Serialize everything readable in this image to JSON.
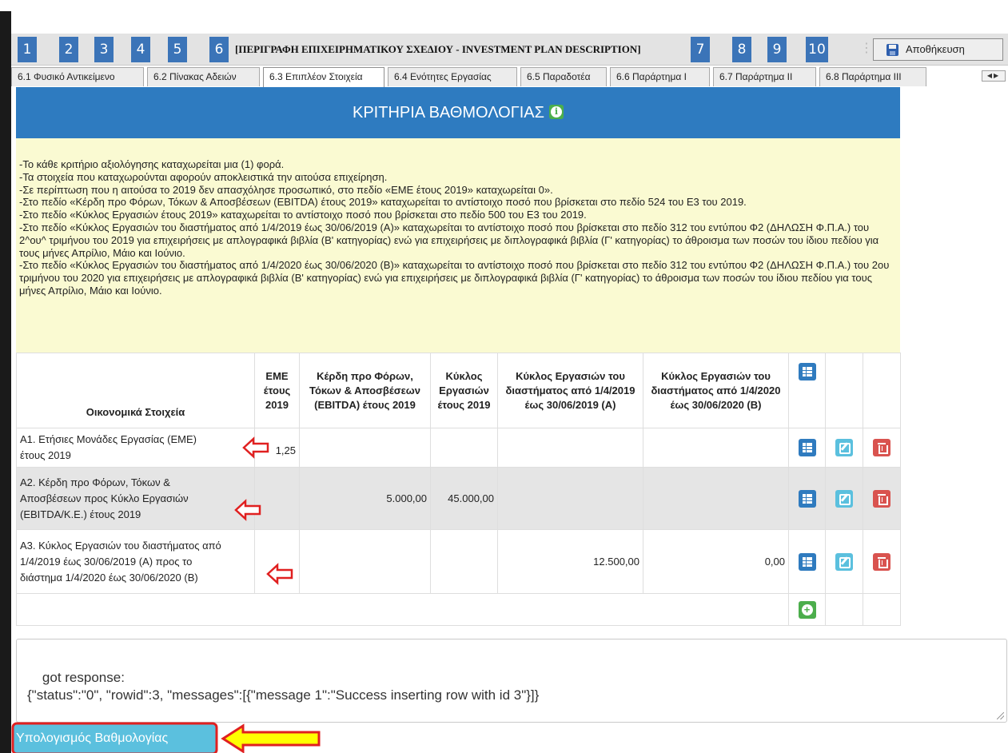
{
  "steps": {
    "buttons": [
      "1",
      "2",
      "3",
      "4",
      "5",
      "6",
      "7",
      "8",
      "9",
      "10"
    ],
    "current_title": "[ΠΕΡΙΓΡΑΦΗ ΕΠΙΧΕΙΡΗΜΑΤΙΚΟΥ ΣΧΕΔΙΟΥ - INVESTMENT PLAN DESCRIPTION]",
    "save_label": "Αποθήκευση"
  },
  "tabs": [
    {
      "label": "6.1 Φυσικό Αντικείμενο"
    },
    {
      "label": "6.2 Πίνακας Αδειών"
    },
    {
      "label": "6.3 Επιπλέον Στοιχεία",
      "active": true
    },
    {
      "label": "6.4 Ενότητες Εργασίας"
    },
    {
      "label": "6.5 Παραδοτέα"
    },
    {
      "label": "6.6 Παράρτημα Ι"
    },
    {
      "label": "6.7 Παράρτημα ΙΙ"
    },
    {
      "label": "6.8 Παράρτημα ΙΙΙ"
    }
  ],
  "panel": {
    "title": "ΚΡΙΤΗΡΙΑ ΒΑΘΜΟΛΟΓΙΑΣ",
    "notes": [
      "-Το κάθε κριτήριο αξιολόγησης καταχωρείται μια (1) φορά.",
      "-Τα στοιχεία που καταχωρούνται αφορούν αποκλειστικά την αιτούσα επιχείρηση.",
      "-Σε περίπτωση που η αιτούσα το 2019 δεν απασχόλησε προσωπικό, στο πεδίο «ΕΜΕ έτους 2019» καταχωρείται 0».",
      "-Στο πεδίο «Κέρδη προ Φόρων, Τόκων & Αποσβέσεων (EBITDA) έτους 2019» καταχωρείται το αντίστοιχο ποσό που βρίσκεται στο πεδίο 524 του Ε3 του 2019.",
      "-Στο πεδίο «Κύκλος Εργασιών έτους 2019» καταχωρείται το αντίστοιχο ποσό που βρίσκεται στο πεδίο 500 του Ε3 του 2019.",
      "-Στο πεδίο «Κύκλος Εργασιών του διαστήματος από 1/4/2019 έως 30/06/2019 (Α)» καταχωρείται το αντίστοιχο ποσό που βρίσκεται στο πεδίο 312 του εντύπου Φ2 (ΔΗΛΩΣΗ Φ.Π.Α.) του 2^ου^ τριμήνου του 2019 για επιχειρήσεις με απλογραφικά βιβλία (Β' κατηγορίας) ενώ για επιχειρήσεις με διπλογραφικά βιβλία (Γ' κατηγορίας) το άθροισμα των ποσών του ίδιου πεδίου για τους μήνες Απρίλιο, Μάιο και Ιούνιο.",
      "-Στο πεδίο «Κύκλος Εργασιών του διαστήματος από 1/4/2020 έως 30/06/2020 (Β)» καταχωρείται το αντίστοιχο ποσό που βρίσκεται στο πεδίο 312 του εντύπου Φ2 (ΔΗΛΩΣΗ Φ.Π.Α.) του 2ου τριμήνου του 2020 για επιχειρήσεις με απλογραφικά βιβλία (Β' κατηγορίας) ενώ για επιχειρήσεις με διπλογραφικά βιβλία (Γ' κατηγορίας) το άθροισμα των ποσών του ίδιου πεδίου για τους μήνες Απρίλιο, Μάιο και Ιούνιο."
    ]
  },
  "table": {
    "headers": [
      "Οικονομικά Στοιχεία",
      "ΕΜΕ έτους 2019",
      "Κέρδη προ Φόρων, Τόκων & Αποσβέσεων (EBITDA) έτους 2019",
      "Κύκλος Εργασιών έτους 2019",
      "Κύκλος Εργασιών του διαστήματος από 1/4/2019 έως 30/06/2019 (Α)",
      "Κύκλος Εργασιών του διαστήματος από 1/4/2020 έως 30/06/2020 (Β)"
    ],
    "rows": [
      {
        "label": "Α1. Ετήσιες Μονάδες Εργασίας (ΕΜΕ) έτους 2019",
        "values": [
          "1,25",
          "",
          "",
          "",
          ""
        ]
      },
      {
        "label": "Α2. Κέρδη προ Φόρων, Τόκων & Αποσβέσεων προς Κύκλο Εργασιών (EBITDA/Κ.Ε.) έτους 2019",
        "values": [
          "",
          "5.000,00",
          "45.000,00",
          "",
          ""
        ]
      },
      {
        "label": "Α3. Κύκλος Εργασιών του διαστήματος από 1/4/2019 έως 30/06/2019 (Α) προς το διάστημα 1/4/2020 έως 30/06/2020 (Β)",
        "values": [
          "",
          "",
          "",
          "12.500,00",
          "0,00"
        ]
      }
    ]
  },
  "console": {
    "text": "got response:\n{\"status\":\"0\", \"rowid\":3, \"messages\":[{\"message 1\":\"Success inserting row with id 3\"}]}"
  },
  "calc_button": {
    "label": "Υπολογισμός Βαθμολογίας"
  },
  "colors": {
    "step_blue": "#3b74b8",
    "banner_blue": "#2e7bc0",
    "notes_yellow": "#fafad2",
    "action_green": "#4cae4c",
    "edit_cyan": "#5bc0de",
    "delete_red": "#d9534f",
    "annotation_red": "#e02020",
    "annotation_yellow": "#ffff00"
  },
  "icons": [
    "info-icon",
    "list-icon",
    "edit-icon",
    "trash-icon",
    "add-icon",
    "save-icon",
    "scroll-arrows-icon"
  ]
}
